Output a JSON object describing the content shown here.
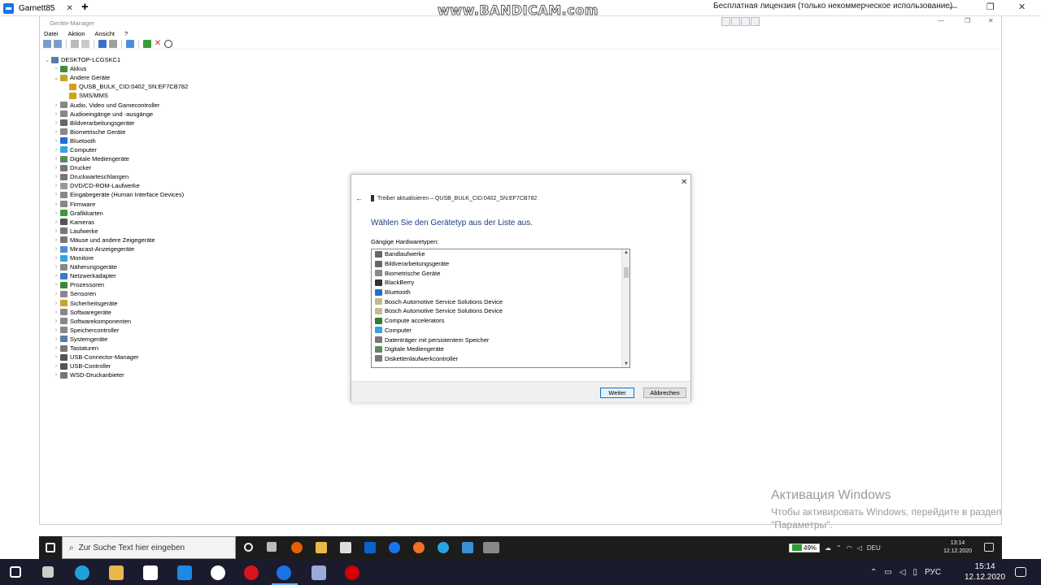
{
  "outer_window": {
    "tab_title": "Garnett85",
    "close_glyph": "✕",
    "new_tab_glyph": "+",
    "license_text": "Бесплатная лицензия (только некоммерческое использование)",
    "min_glyph": "—",
    "max_glyph": "❐",
    "close_win_glyph": "✕"
  },
  "recorder_watermark": "www.BANDICAM.com",
  "device_manager": {
    "title": "Geräte-Manager",
    "min_glyph": "—",
    "max_glyph": "❐",
    "close_glyph": "✕",
    "menu": [
      "Datei",
      "Aktion",
      "Ansicht",
      "?"
    ],
    "tree": [
      {
        "label": "DESKTOP-LCGSKC1",
        "level": 0,
        "expander": "⌄",
        "color": "#5a7ca8"
      },
      {
        "label": "Akkus",
        "level": 1,
        "expander": "›",
        "color": "#3c8d3c"
      },
      {
        "label": "Andere Geräte",
        "level": 1,
        "expander": "⌄",
        "color": "#c9a227"
      },
      {
        "label": "QUSB_BULK_CID:0402_SN:EF7CB782",
        "level": 2,
        "expander": "",
        "color": "#d4a017"
      },
      {
        "label": "SMS/MMS",
        "level": 2,
        "expander": "",
        "color": "#d4a017"
      },
      {
        "label": "Audio, Video und Gamecontroller",
        "level": 1,
        "expander": "›",
        "color": "#888888"
      },
      {
        "label": "Audioeingänge und -ausgänge",
        "level": 1,
        "expander": "›",
        "color": "#888888"
      },
      {
        "label": "Bildverarbeitungsgeräte",
        "level": 1,
        "expander": "›",
        "color": "#666666"
      },
      {
        "label": "Biometrische Geräte",
        "level": 1,
        "expander": "›",
        "color": "#888888"
      },
      {
        "label": "Bluetooth",
        "level": 1,
        "expander": "›",
        "color": "#1e6fd9"
      },
      {
        "label": "Computer",
        "level": 1,
        "expander": "›",
        "color": "#3aa0e0"
      },
      {
        "label": "Digitale Mediengeräte",
        "level": 1,
        "expander": "›",
        "color": "#5a8a5a"
      },
      {
        "label": "Drucker",
        "level": 1,
        "expander": "›",
        "color": "#777777"
      },
      {
        "label": "Druckwarteschlangen",
        "level": 1,
        "expander": "›",
        "color": "#777777"
      },
      {
        "label": "DVD/CD-ROM-Laufwerke",
        "level": 1,
        "expander": "›",
        "color": "#999999"
      },
      {
        "label": "Eingabegeräte (Human Interface Devices)",
        "level": 1,
        "expander": "›",
        "color": "#888888"
      },
      {
        "label": "Firmware",
        "level": 1,
        "expander": "›",
        "color": "#888888"
      },
      {
        "label": "Grafikkarten",
        "level": 1,
        "expander": "›",
        "color": "#3a9a3a"
      },
      {
        "label": "Kameras",
        "level": 1,
        "expander": "›",
        "color": "#555555"
      },
      {
        "label": "Laufwerke",
        "level": 1,
        "expander": "›",
        "color": "#777777"
      },
      {
        "label": "Mäuse und andere Zeigegeräte",
        "level": 1,
        "expander": "›",
        "color": "#777777"
      },
      {
        "label": "Miracast-Anzeigegeräte",
        "level": 1,
        "expander": "›",
        "color": "#4a90d9"
      },
      {
        "label": "Monitore",
        "level": 1,
        "expander": "›",
        "color": "#3aa0e0"
      },
      {
        "label": "Näherungsgeräte",
        "level": 1,
        "expander": "›",
        "color": "#888888"
      },
      {
        "label": "Netzwerkadapter",
        "level": 1,
        "expander": "›",
        "color": "#3a7ac8"
      },
      {
        "label": "Prozessoren",
        "level": 1,
        "expander": "›",
        "color": "#3a8a3a"
      },
      {
        "label": "Sensoren",
        "level": 1,
        "expander": "›",
        "color": "#888888"
      },
      {
        "label": "Sicherheitsgeräte",
        "level": 1,
        "expander": "›",
        "color": "#c9a227"
      },
      {
        "label": "Softwaregeräte",
        "level": 1,
        "expander": "›",
        "color": "#888888"
      },
      {
        "label": "Softwarekomponenten",
        "level": 1,
        "expander": "›",
        "color": "#888888"
      },
      {
        "label": "Speichercontroller",
        "level": 1,
        "expander": "›",
        "color": "#888888"
      },
      {
        "label": "Systemgeräte",
        "level": 1,
        "expander": "›",
        "color": "#5a7ca8"
      },
      {
        "label": "Tastaturen",
        "level": 1,
        "expander": "›",
        "color": "#777777"
      },
      {
        "label": "USB-Connector-Manager",
        "level": 1,
        "expander": "›",
        "color": "#555555"
      },
      {
        "label": "USB-Controller",
        "level": 1,
        "expander": "›",
        "color": "#555555"
      },
      {
        "label": "WSD-Druckanbieter",
        "level": 1,
        "expander": "›",
        "color": "#777777"
      }
    ]
  },
  "dialog": {
    "close_glyph": "✕",
    "back_glyph": "←",
    "title": "Treiber aktualisieren – QUSB_BULK_CID:0402_SN:EF7CB782",
    "heading": "Wählen Sie den Gerätetyp aus der Liste aus.",
    "list_label": "Gängige Hardwaretypen:",
    "items": [
      {
        "label": "Bandlaufwerke",
        "color": "#666666"
      },
      {
        "label": "Bildverarbeitungsgeräte",
        "color": "#666666"
      },
      {
        "label": "Biometrische Geräte",
        "color": "#888888"
      },
      {
        "label": "BlackBerry",
        "color": "#333333"
      },
      {
        "label": "Bluetooth",
        "color": "#1e6fd9"
      },
      {
        "label": "Bosch Automotive Service Solutions Device",
        "color": "#c8b890"
      },
      {
        "label": "Bosch Automotive Service Solutions Device",
        "color": "#c8b890"
      },
      {
        "label": "Compute accelerators",
        "color": "#2e7d32"
      },
      {
        "label": "Computer",
        "color": "#3aa0e0"
      },
      {
        "label": "Datenträger mit persistentem Speicher",
        "color": "#777777"
      },
      {
        "label": "Digitale Mediengeräte",
        "color": "#5a8a5a"
      },
      {
        "label": "Diskettenlaufwerkcontroller",
        "color": "#777777"
      }
    ],
    "scroll_up": "▲",
    "scroll_down": "▼",
    "next_label": "Weiter",
    "cancel_label": "Abbrechen"
  },
  "activation": {
    "title": "Активация Windows",
    "line1": "Чтобы активировать Windows, перейдите в раздел",
    "line2": "\"Параметры\"."
  },
  "inner_taskbar": {
    "search_placeholder": "Zur Suche Text hier eingeben",
    "search_glyph": "⌕",
    "battery": "49%",
    "lang": "DEU",
    "time": "13:14",
    "date": "12.12.2020"
  },
  "outer_taskbar": {
    "lang": "РУС",
    "time": "15:14",
    "date": "12.12.2020"
  }
}
